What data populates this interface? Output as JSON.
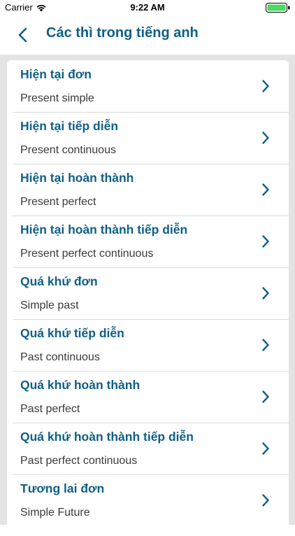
{
  "status_bar": {
    "carrier": "Carrier",
    "time": "9:22 AM"
  },
  "nav": {
    "title": "Các thì trong tiếng anh"
  },
  "colors": {
    "accent": "#0f5f86",
    "subtitle": "#3a3a3a",
    "background": "#e4e4e4",
    "battery": "#4cd964"
  },
  "tenses": [
    {
      "vi": "Hiện tại đơn",
      "en": "Present simple"
    },
    {
      "vi": "Hiện tại tiếp diễn",
      "en": "Present continuous"
    },
    {
      "vi": "Hiện tại hoàn thành",
      "en": "Present perfect"
    },
    {
      "vi": "Hiện tại hoàn thành tiếp diễn",
      "en": "Present perfect continuous"
    },
    {
      "vi": "Quá khứ đơn",
      "en": "Simple past"
    },
    {
      "vi": "Quá khứ tiếp diễn",
      "en": "Past continuous"
    },
    {
      "vi": "Quá khứ hoàn thành",
      "en": "Past perfect"
    },
    {
      "vi": "Quá khứ hoàn thành tiếp diễn",
      "en": "Past perfect continuous"
    },
    {
      "vi": "Tương lai đơn",
      "en": "Simple Future"
    }
  ]
}
